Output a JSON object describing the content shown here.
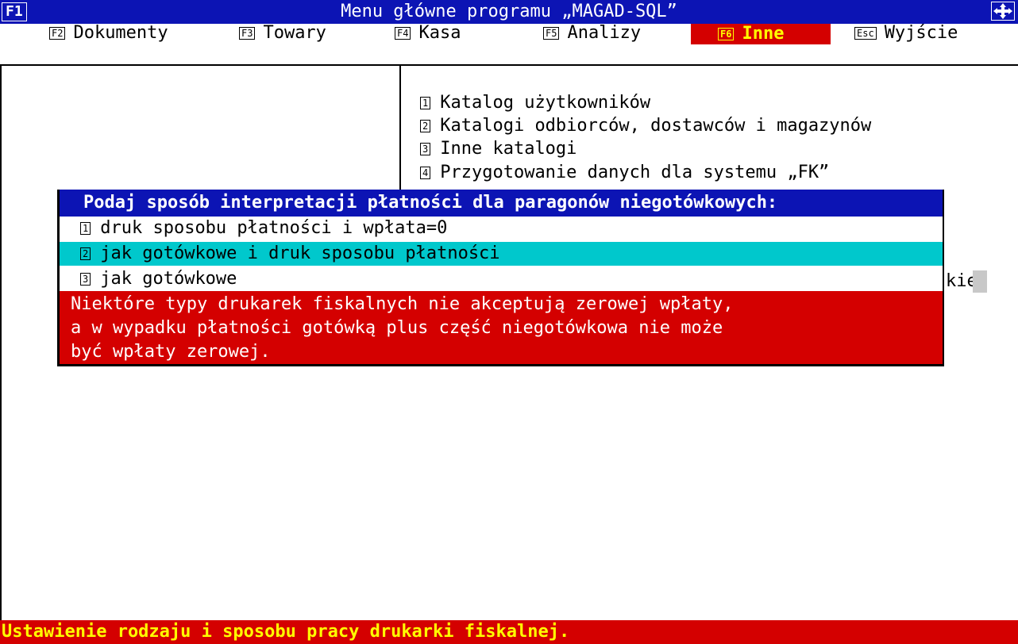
{
  "titlebar": {
    "key": "F1",
    "title": "Menu główne programu „MAGAD-SQL”",
    "move_icon": "move-arrows-icon"
  },
  "menu": [
    {
      "key": "F2",
      "label": "Dokumenty"
    },
    {
      "key": "F3",
      "label": "Towary"
    },
    {
      "key": "F4",
      "label": "Kasa"
    },
    {
      "key": "F5",
      "label": "Analizy"
    },
    {
      "key": "F6",
      "label": "Inne",
      "active": true
    },
    {
      "key": "Esc",
      "label": "Wyjście"
    }
  ],
  "submenu": {
    "items": [
      {
        "key": "1",
        "label": "Katalog użytkowników"
      },
      {
        "key": "2",
        "label": "Katalogi odbiorców, dostawców i magazynów"
      },
      {
        "key": "3",
        "label": "Inne katalogi"
      },
      {
        "key": "4",
        "label": "Przygotowanie danych dla systemu „FK”"
      }
    ],
    "partial_text": "kiet"
  },
  "dialog": {
    "header": "Podaj sposób interpretacji płatności dla paragonów niegotówkowych:",
    "options": [
      {
        "key": "1",
        "label": "druk sposobu płatności i wpłata=0"
      },
      {
        "key": "2",
        "label": "jak gotówkowe i druk sposobu płatności",
        "selected": true
      },
      {
        "key": "3",
        "label": "jak gotówkowe"
      }
    ],
    "info": [
      "Niektóre typy drukarek fiskalnych nie akceptują zerowej wpłaty,",
      "a w wypadku płatności gotówką plus część niegotówkowa nie może",
      "być wpłaty zerowej."
    ]
  },
  "statusbar": {
    "text": "Ustawienie rodzaju i sposobu pracy drukarki fiskalnej."
  },
  "colors": {
    "title_bg": "#0c14b4",
    "active_menu_bg": "#d40000",
    "active_menu_fg": "#ffff00",
    "selected_option_bg": "#00c8cc",
    "info_bg": "#d40000",
    "status_bg": "#d40000",
    "status_fg": "#ffff00"
  }
}
